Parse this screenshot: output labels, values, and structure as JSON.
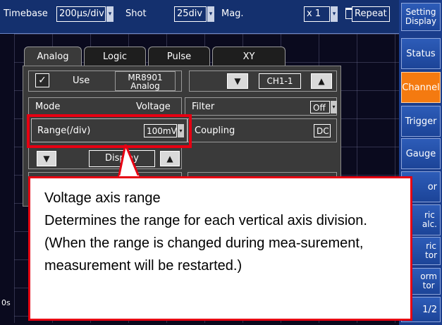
{
  "topbar": {
    "timebase_label": "Timebase",
    "timebase_value": "200µs/div",
    "shot_label": "Shot",
    "shot_value": "25div",
    "mag_label": "Mag.",
    "mag_value": "x 1",
    "repeat_label": "Repeat"
  },
  "right_menu": {
    "setting_display": "Setting Display",
    "status": "Status",
    "channel": "Channel",
    "trigger": "Trigger",
    "gauge": "Gauge",
    "partial_1": "or",
    "partial_2": "ric\nalc.",
    "partial_3": "ric\ntor",
    "partial_4": "orm\ntor",
    "page": "1/2"
  },
  "dialog": {
    "tabs": [
      "Analog",
      "Logic",
      "Pulse",
      "XY"
    ],
    "use_label": "Use",
    "use_checked": "✓",
    "model_label": "MR8901\nAnalog",
    "channel_value": "CH1-1",
    "mode_label": "Mode",
    "mode_value": "Voltage",
    "filter_label": "Filter",
    "filter_value": "Off",
    "range_label": "Range(/div)",
    "range_value": "100mV",
    "coupling_label": "Coupling",
    "coupling_value": "DC",
    "display_label": "Display"
  },
  "waveform": {
    "start_label": "0s"
  },
  "callout": {
    "title": "Voltage axis range",
    "line1": "Determines the range for each vertical axis division.",
    "line2": "(When the range is changed during mea-surement, measurement will be restarted.)"
  },
  "colors": {
    "accent_orange": "#f47a10",
    "highlight_red": "#e60012",
    "topbar_blue": "#14306e"
  }
}
